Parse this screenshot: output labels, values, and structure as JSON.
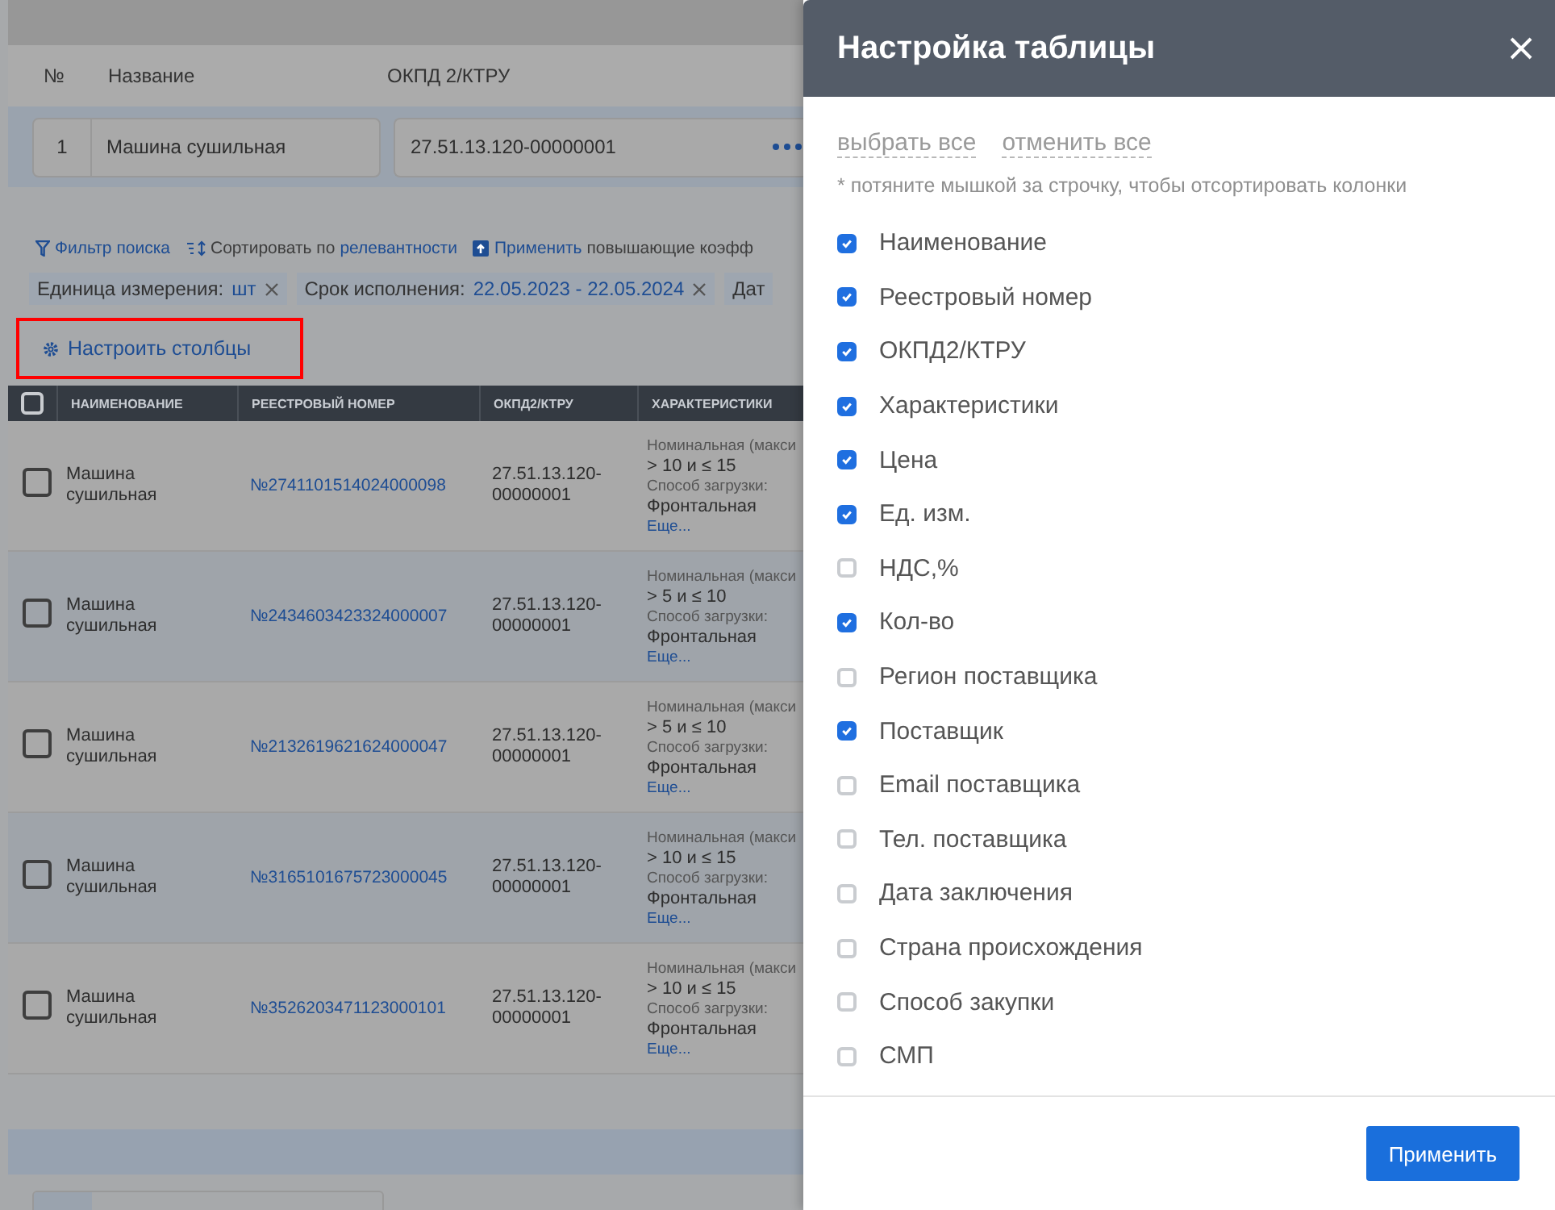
{
  "header_columns": [
    "№",
    "Название",
    "ОКПД 2/КТРУ"
  ],
  "item": {
    "number": "1",
    "name": "Машина сушильная",
    "code": "27.51.13.120-00000001"
  },
  "toolbar": {
    "filter": "Фильтр поиска",
    "sort_label": "Сортировать по",
    "sort_value": "релевантности",
    "apply_link": "Применить",
    "apply_rest": "повышающие коэфф"
  },
  "chips": [
    {
      "label": "Единица измерения:",
      "value": "шт",
      "closable": true
    },
    {
      "label": "Срок исполнения:",
      "value": "22.05.2023 - 22.05.2024",
      "closable": true
    },
    {
      "label": "Дат",
      "closable": false
    }
  ],
  "configure_button": "Настроить столбцы",
  "table": {
    "header_checked": false,
    "columns": [
      "НАИМЕНОВАНИЕ",
      "РЕЕСТРОВЫЙ НОМЕР",
      "ОКПД2/КТРУ",
      "ХАРАКТЕРИСТИКИ"
    ],
    "rows": [
      {
        "checked": false,
        "name": "Машина сушильная",
        "registry_number": "№2741101514024000098",
        "code": "27.51.13.120-00000001",
        "char_label_1": "Номинальная (макси",
        "char_value_1": "> 10 и ≤ 15",
        "char_label_2": "Способ загрузки:",
        "char_value_2": "Фронтальная",
        "more": "Еще..."
      },
      {
        "checked": false,
        "name": "Машина сушильная",
        "registry_number": "№2434603423324000007",
        "code": "27.51.13.120-00000001",
        "char_label_1": "Номинальная (макси",
        "char_value_1": "> 5 и ≤ 10",
        "char_label_2": "Способ загрузки:",
        "char_value_2": "Фронтальная",
        "more": "Еще..."
      },
      {
        "checked": false,
        "name": "Машина сушильная",
        "registry_number": "№2132619621624000047",
        "code": "27.51.13.120-00000001",
        "char_label_1": "Номинальная (макси",
        "char_value_1": "> 5 и ≤ 10",
        "char_label_2": "Способ загрузки:",
        "char_value_2": "Фронтальная",
        "more": "Еще..."
      },
      {
        "checked": false,
        "name": "Машина сушильная",
        "registry_number": "№3165101675723000045",
        "code": "27.51.13.120-00000001",
        "char_label_1": "Номинальная (макси",
        "char_value_1": "> 10 и ≤ 15",
        "char_label_2": "Способ загрузки:",
        "char_value_2": "Фронтальная",
        "more": "Еще..."
      },
      {
        "checked": false,
        "name": "Машина сушильная",
        "registry_number": "№3526203471123000101",
        "code": "27.51.13.120-00000001",
        "char_label_1": "Номинальная (макси",
        "char_value_1": "> 10 и ≤ 15",
        "char_label_2": "Способ загрузки:",
        "char_value_2": "Фронтальная",
        "more": "Еще..."
      }
    ]
  },
  "panel": {
    "title": "Настройка таблицы",
    "select_all": "выбрать все",
    "deselect_all": "отменить все",
    "hint": "* потяните мышкой за строчку, чтобы отсортировать колонки",
    "columns": [
      {
        "label": "Наименование",
        "checked": true
      },
      {
        "label": "Реестровый номер",
        "checked": true
      },
      {
        "label": "ОКПД2/КТРУ",
        "checked": true
      },
      {
        "label": "Характеристики",
        "checked": true
      },
      {
        "label": "Цена",
        "checked": true
      },
      {
        "label": "Ед. изм.",
        "checked": true
      },
      {
        "label": "НДС,%",
        "checked": false
      },
      {
        "label": "Кол-во",
        "checked": true
      },
      {
        "label": "Регион поставщика",
        "checked": false
      },
      {
        "label": "Поставщик",
        "checked": true
      },
      {
        "label": "Email поставщика",
        "checked": false
      },
      {
        "label": "Тел. поставщика",
        "checked": false
      },
      {
        "label": "Дата заключения",
        "checked": false
      },
      {
        "label": "Страна происхождения",
        "checked": false
      },
      {
        "label": "Способ закупки",
        "checked": false
      },
      {
        "label": "СМП",
        "checked": false
      }
    ],
    "apply_button": "Применить"
  }
}
